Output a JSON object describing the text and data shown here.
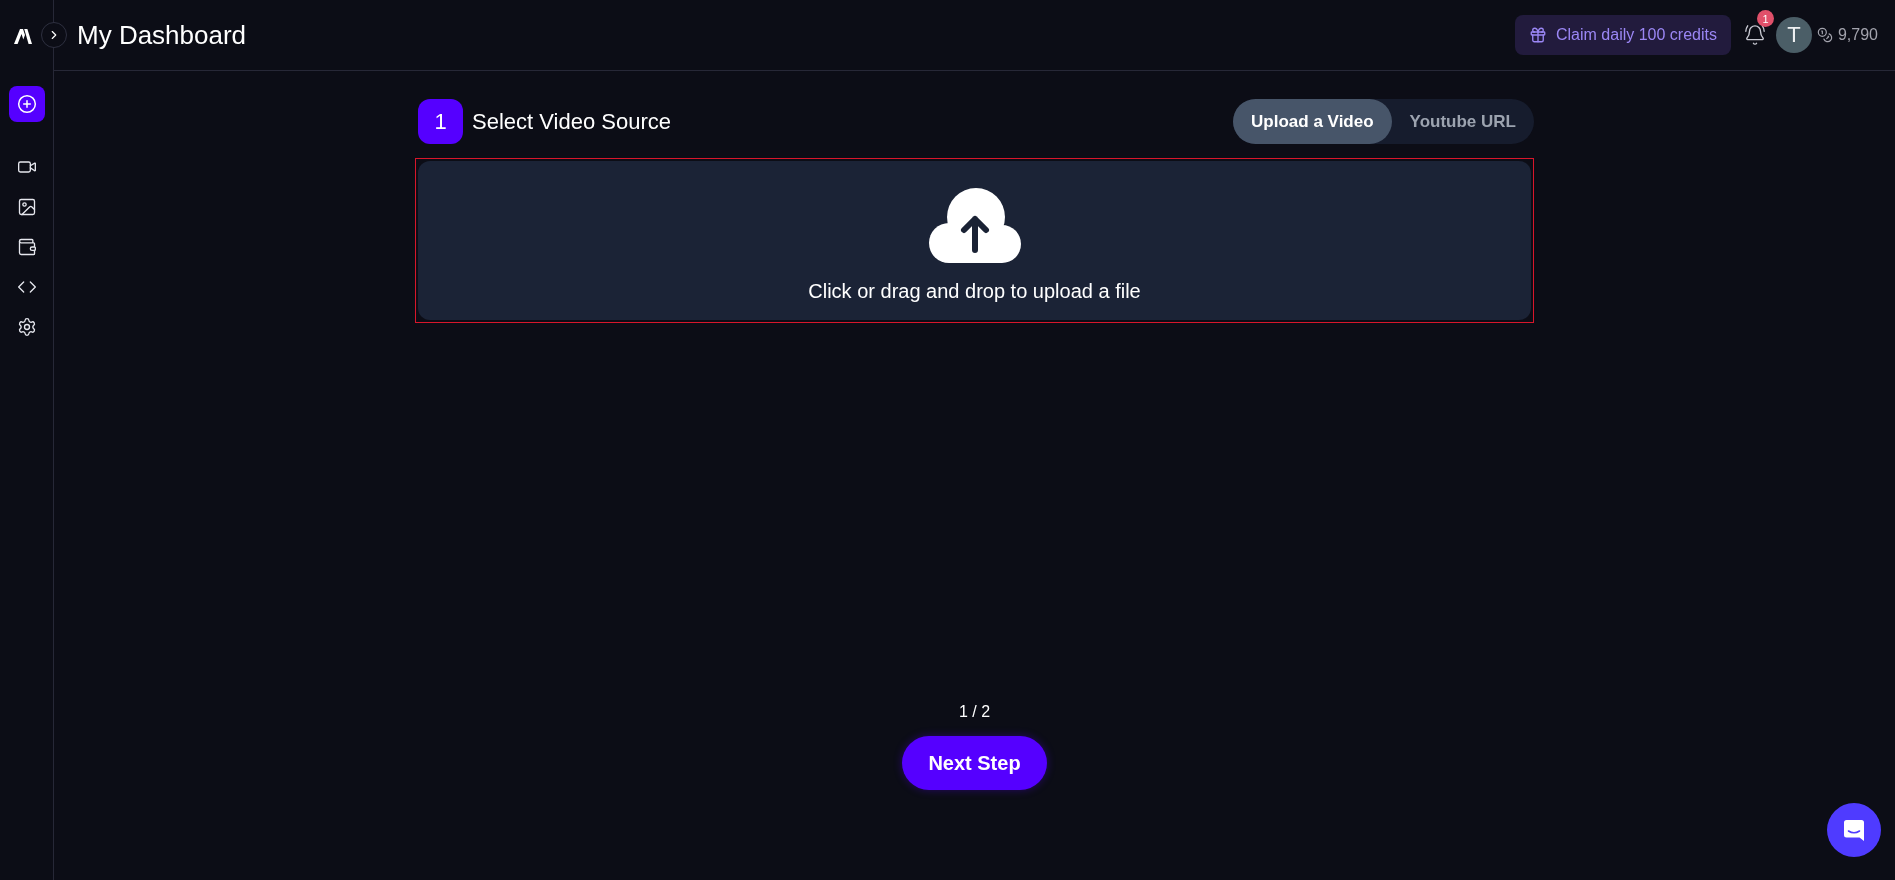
{
  "header": {
    "title": "My Dashboard",
    "claim_button": "Claim daily 100 credits",
    "notification_count": "1",
    "avatar_initial": "T",
    "credits": "9,790"
  },
  "step": {
    "number": "1",
    "title": "Select Video Source"
  },
  "source_tabs": [
    {
      "label": "Upload a Video",
      "selected": true
    },
    {
      "label": "Youtube URL",
      "selected": false
    }
  ],
  "dropzone": {
    "text": "Click or drag and drop to upload a file"
  },
  "pager": {
    "progress": "1 / 2",
    "next_button": "Next Step"
  }
}
